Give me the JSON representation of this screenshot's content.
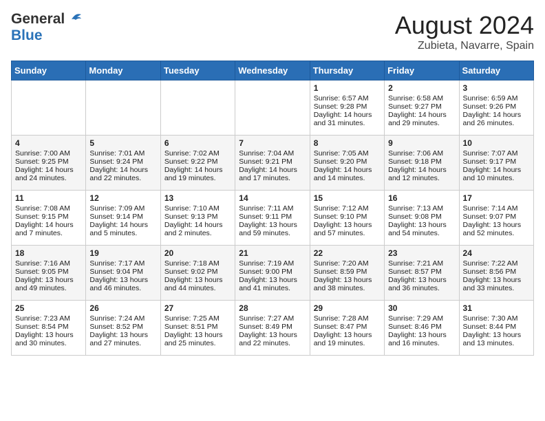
{
  "logo": {
    "general": "General",
    "blue": "Blue"
  },
  "title": "August 2024",
  "location": "Zubieta, Navarre, Spain",
  "days_of_week": [
    "Sunday",
    "Monday",
    "Tuesday",
    "Wednesday",
    "Thursday",
    "Friday",
    "Saturday"
  ],
  "weeks": [
    [
      {
        "day": "",
        "content": ""
      },
      {
        "day": "",
        "content": ""
      },
      {
        "day": "",
        "content": ""
      },
      {
        "day": "",
        "content": ""
      },
      {
        "day": "1",
        "content": "Sunrise: 6:57 AM\nSunset: 9:28 PM\nDaylight: 14 hours\nand 31 minutes."
      },
      {
        "day": "2",
        "content": "Sunrise: 6:58 AM\nSunset: 9:27 PM\nDaylight: 14 hours\nand 29 minutes."
      },
      {
        "day": "3",
        "content": "Sunrise: 6:59 AM\nSunset: 9:26 PM\nDaylight: 14 hours\nand 26 minutes."
      }
    ],
    [
      {
        "day": "4",
        "content": "Sunrise: 7:00 AM\nSunset: 9:25 PM\nDaylight: 14 hours\nand 24 minutes."
      },
      {
        "day": "5",
        "content": "Sunrise: 7:01 AM\nSunset: 9:24 PM\nDaylight: 14 hours\nand 22 minutes."
      },
      {
        "day": "6",
        "content": "Sunrise: 7:02 AM\nSunset: 9:22 PM\nDaylight: 14 hours\nand 19 minutes."
      },
      {
        "day": "7",
        "content": "Sunrise: 7:04 AM\nSunset: 9:21 PM\nDaylight: 14 hours\nand 17 minutes."
      },
      {
        "day": "8",
        "content": "Sunrise: 7:05 AM\nSunset: 9:20 PM\nDaylight: 14 hours\nand 14 minutes."
      },
      {
        "day": "9",
        "content": "Sunrise: 7:06 AM\nSunset: 9:18 PM\nDaylight: 14 hours\nand 12 minutes."
      },
      {
        "day": "10",
        "content": "Sunrise: 7:07 AM\nSunset: 9:17 PM\nDaylight: 14 hours\nand 10 minutes."
      }
    ],
    [
      {
        "day": "11",
        "content": "Sunrise: 7:08 AM\nSunset: 9:15 PM\nDaylight: 14 hours\nand 7 minutes."
      },
      {
        "day": "12",
        "content": "Sunrise: 7:09 AM\nSunset: 9:14 PM\nDaylight: 14 hours\nand 5 minutes."
      },
      {
        "day": "13",
        "content": "Sunrise: 7:10 AM\nSunset: 9:13 PM\nDaylight: 14 hours\nand 2 minutes."
      },
      {
        "day": "14",
        "content": "Sunrise: 7:11 AM\nSunset: 9:11 PM\nDaylight: 13 hours\nand 59 minutes."
      },
      {
        "day": "15",
        "content": "Sunrise: 7:12 AM\nSunset: 9:10 PM\nDaylight: 13 hours\nand 57 minutes."
      },
      {
        "day": "16",
        "content": "Sunrise: 7:13 AM\nSunset: 9:08 PM\nDaylight: 13 hours\nand 54 minutes."
      },
      {
        "day": "17",
        "content": "Sunrise: 7:14 AM\nSunset: 9:07 PM\nDaylight: 13 hours\nand 52 minutes."
      }
    ],
    [
      {
        "day": "18",
        "content": "Sunrise: 7:16 AM\nSunset: 9:05 PM\nDaylight: 13 hours\nand 49 minutes."
      },
      {
        "day": "19",
        "content": "Sunrise: 7:17 AM\nSunset: 9:04 PM\nDaylight: 13 hours\nand 46 minutes."
      },
      {
        "day": "20",
        "content": "Sunrise: 7:18 AM\nSunset: 9:02 PM\nDaylight: 13 hours\nand 44 minutes."
      },
      {
        "day": "21",
        "content": "Sunrise: 7:19 AM\nSunset: 9:00 PM\nDaylight: 13 hours\nand 41 minutes."
      },
      {
        "day": "22",
        "content": "Sunrise: 7:20 AM\nSunset: 8:59 PM\nDaylight: 13 hours\nand 38 minutes."
      },
      {
        "day": "23",
        "content": "Sunrise: 7:21 AM\nSunset: 8:57 PM\nDaylight: 13 hours\nand 36 minutes."
      },
      {
        "day": "24",
        "content": "Sunrise: 7:22 AM\nSunset: 8:56 PM\nDaylight: 13 hours\nand 33 minutes."
      }
    ],
    [
      {
        "day": "25",
        "content": "Sunrise: 7:23 AM\nSunset: 8:54 PM\nDaylight: 13 hours\nand 30 minutes."
      },
      {
        "day": "26",
        "content": "Sunrise: 7:24 AM\nSunset: 8:52 PM\nDaylight: 13 hours\nand 27 minutes."
      },
      {
        "day": "27",
        "content": "Sunrise: 7:25 AM\nSunset: 8:51 PM\nDaylight: 13 hours\nand 25 minutes."
      },
      {
        "day": "28",
        "content": "Sunrise: 7:27 AM\nSunset: 8:49 PM\nDaylight: 13 hours\nand 22 minutes."
      },
      {
        "day": "29",
        "content": "Sunrise: 7:28 AM\nSunset: 8:47 PM\nDaylight: 13 hours\nand 19 minutes."
      },
      {
        "day": "30",
        "content": "Sunrise: 7:29 AM\nSunset: 8:46 PM\nDaylight: 13 hours\nand 16 minutes."
      },
      {
        "day": "31",
        "content": "Sunrise: 7:30 AM\nSunset: 8:44 PM\nDaylight: 13 hours\nand 13 minutes."
      }
    ]
  ]
}
